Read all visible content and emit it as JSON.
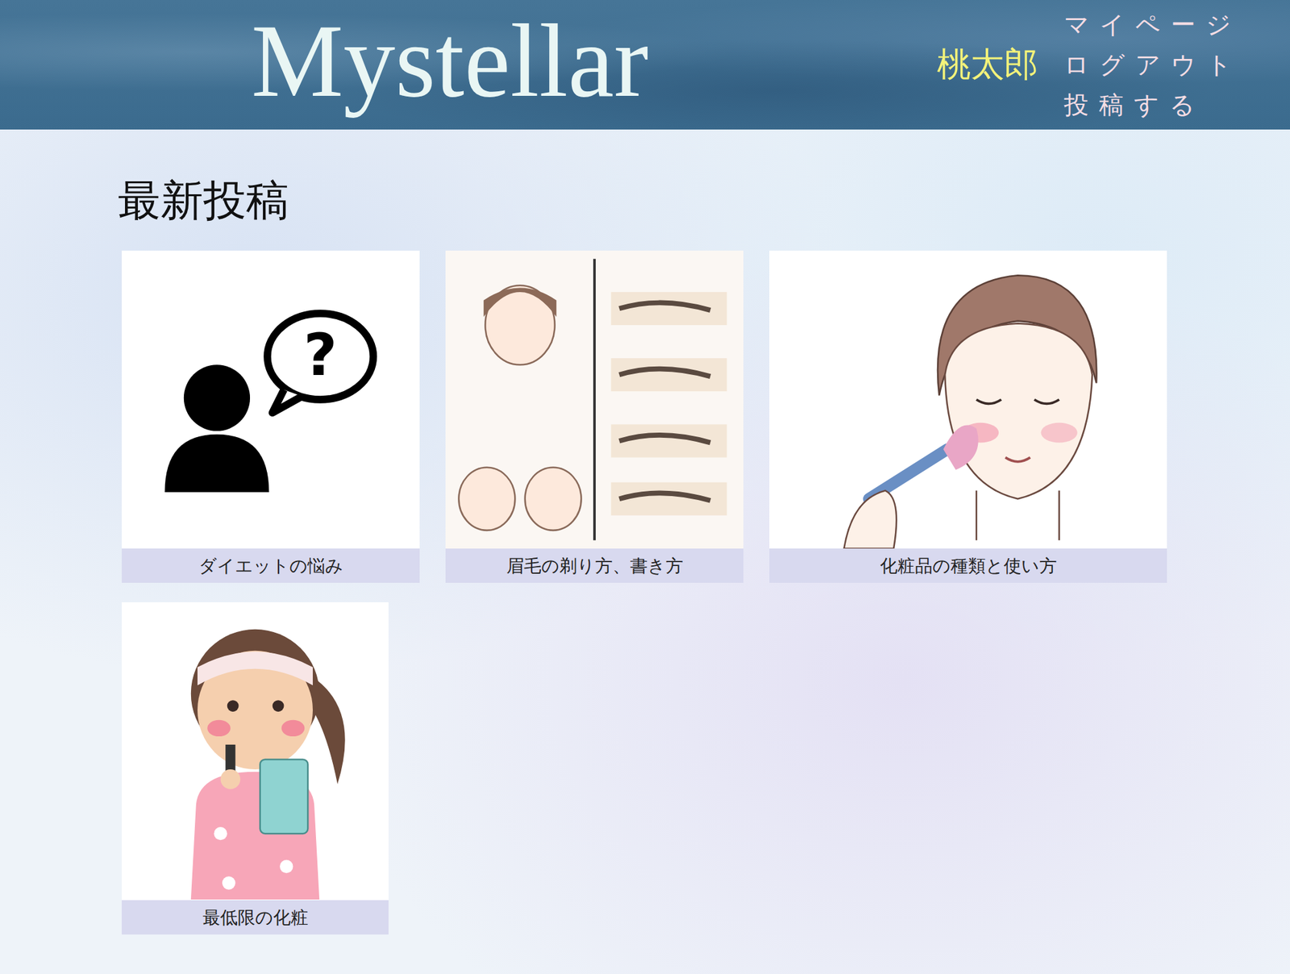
{
  "header": {
    "logo": "Mystellar",
    "user_name": "桃太郎",
    "nav": [
      "マイページ",
      "ログアウト",
      "投稿する"
    ]
  },
  "section": {
    "title": "最新投稿"
  },
  "posts": [
    {
      "title": "ダイエットの悩み",
      "icon": "?"
    },
    {
      "title": "眉毛の剃り方、書き方"
    },
    {
      "title": "化粧品の種類と使い方"
    },
    {
      "title": "最低限の化粧"
    }
  ]
}
